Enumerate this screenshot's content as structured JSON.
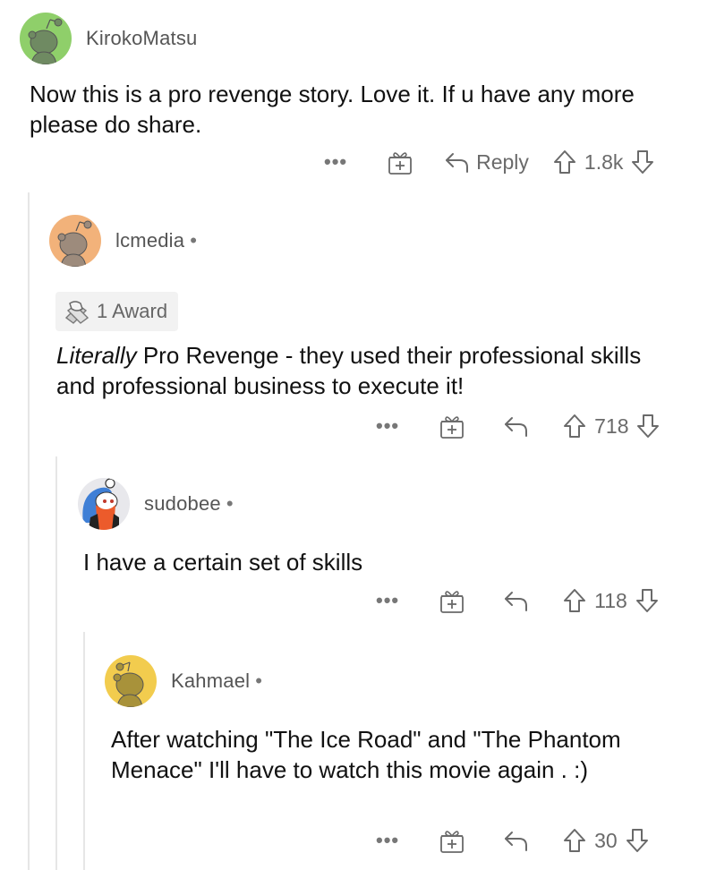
{
  "comments": [
    {
      "username": "KirokoMatsu",
      "avatar_color": "#8fcf6a",
      "avatar_figure_color": "#6f8a62",
      "body": "Now this is a pro revenge story. Love it. If u have any more please do share.",
      "actions": {
        "more": "•••",
        "reply": "Reply",
        "score": "1.8k"
      }
    },
    {
      "username": "lcmedia",
      "separator": "•",
      "avatar_color": "#f2b27a",
      "avatar_figure_color": "#9d8b7c",
      "award": {
        "label": "1 Award",
        "icon": "handshake-award-icon"
      },
      "body_italic": "Literally",
      "body": " Pro Revenge - they used their professional skills and professional business to execute it!",
      "actions": {
        "more": "•••",
        "score": "718"
      }
    },
    {
      "username": "sudobee",
      "separator": "•",
      "avatar_color": "#e8e8ec",
      "body": "I have a certain set of skills",
      "actions": {
        "more": "•••",
        "score": "118"
      }
    },
    {
      "username": "Kahmael",
      "separator": "•",
      "avatar_color": "#f2cc4e",
      "avatar_figure_color": "#a8923a",
      "body": "After watching \"The Ice Road\" and \"The Phantom Menace\" I'll have to watch this movie again . :)",
      "actions": {
        "more": "•••",
        "score": "30"
      }
    }
  ]
}
